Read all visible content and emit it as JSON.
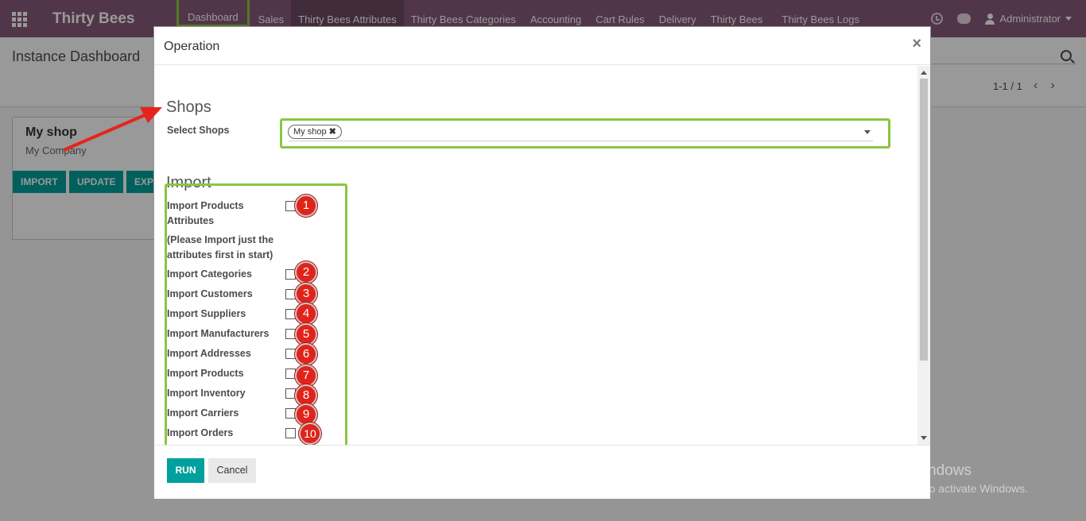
{
  "topbar": {
    "brand": "Thirty Bees",
    "menu": [
      "Dashboard",
      "Sales",
      "Thirty Bees Attributes",
      "Thirty Bees Categories",
      "Accounting",
      "Cart Rules",
      "Delivery",
      "Thirty Bees",
      "Thirty Bees Logs"
    ],
    "user": "Administrator"
  },
  "page": {
    "title": "Instance Dashboard",
    "pager": "1-1 / 1",
    "card": {
      "name": "My shop",
      "company": "My Company",
      "buttons": [
        "IMPORT",
        "UPDATE",
        "EXP"
      ]
    }
  },
  "modal": {
    "title": "Operation",
    "close": "×",
    "shops_section": "Shops",
    "select_label": "Select Shops",
    "selected_tag": "My shop",
    "import_section": "Import",
    "import_items": [
      {
        "label": "Import Products Attributes",
        "badge": "1"
      },
      {
        "label": "(Please Import just the attributes first in start)",
        "badge": ""
      },
      {
        "label": "Import Categories",
        "badge": "2"
      },
      {
        "label": "Import Customers",
        "badge": "3"
      },
      {
        "label": "Import Suppliers",
        "badge": "4"
      },
      {
        "label": "Import Manufacturers",
        "badge": "5"
      },
      {
        "label": "Import Addresses",
        "badge": "6"
      },
      {
        "label": "Import Products",
        "badge": "7"
      },
      {
        "label": "Import Inventory",
        "badge": "8"
      },
      {
        "label": "Import Carriers",
        "badge": "9"
      },
      {
        "label": "Import Orders",
        "badge": "10"
      }
    ],
    "run_label": "RUN",
    "cancel_label": "Cancel"
  },
  "watermark": {
    "line1": "Activate Windows",
    "line2": "Go to Settings to activate Windows."
  },
  "colors": {
    "nav": "#875a7b",
    "primary": "#00a09d",
    "highlight": "#8cc63f",
    "badge": "#e0241b"
  }
}
